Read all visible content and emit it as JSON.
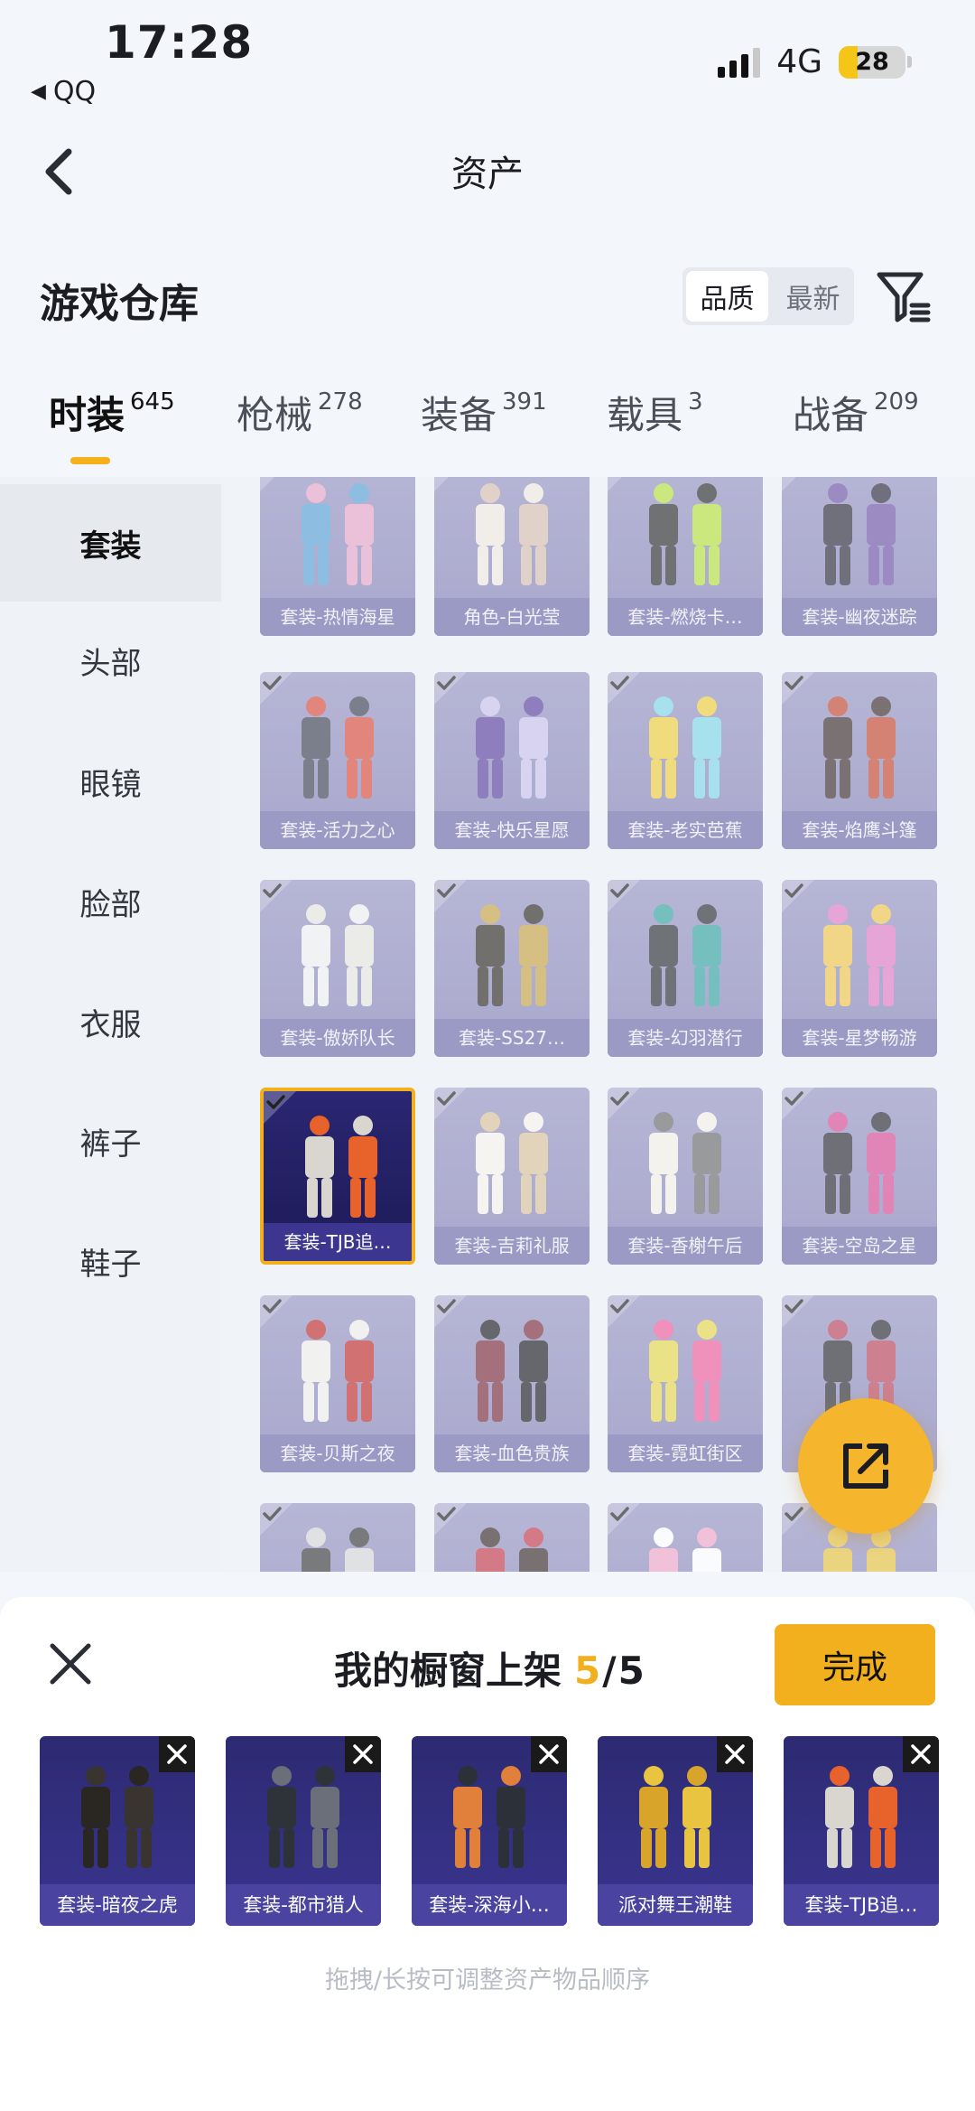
{
  "status_bar": {
    "time": "17:28",
    "back_app": "QQ",
    "network": "4G",
    "battery": "28",
    "battery_level_percent": 28
  },
  "nav": {
    "title": "资产"
  },
  "warehouse": {
    "title": "游戏仓库",
    "sort_options": [
      "品质",
      "最新"
    ],
    "sort_selected": "品质"
  },
  "tabs": [
    {
      "label": "时装",
      "count": "645",
      "active": true
    },
    {
      "label": "枪械",
      "count": "278",
      "active": false
    },
    {
      "label": "装备",
      "count": "391",
      "active": false
    },
    {
      "label": "载具",
      "count": "3",
      "active": false
    },
    {
      "label": "战备",
      "count": "209",
      "active": false
    }
  ],
  "sidebar": {
    "items": [
      {
        "label": "套装",
        "active": true
      },
      {
        "label": "头部",
        "active": false
      },
      {
        "label": "眼镜",
        "active": false
      },
      {
        "label": "脸部",
        "active": false
      },
      {
        "label": "衣服",
        "active": false
      },
      {
        "label": "裤子",
        "active": false
      },
      {
        "label": "鞋子",
        "active": false
      }
    ]
  },
  "grid": {
    "items": [
      {
        "caption": "套装-热情海星",
        "selected": false
      },
      {
        "caption": "角色-白光莹",
        "selected": false
      },
      {
        "caption": "套装-燃烧卡…",
        "selected": false
      },
      {
        "caption": "套装-幽夜迷踪",
        "selected": false
      },
      {
        "caption": "套装-活力之心",
        "selected": false
      },
      {
        "caption": "套装-快乐星愿",
        "selected": false
      },
      {
        "caption": "套装-老实芭蕉",
        "selected": false
      },
      {
        "caption": "套装-焰鹰斗篷",
        "selected": false
      },
      {
        "caption": "套装-傲娇队长",
        "selected": false
      },
      {
        "caption": "套装-SS27…",
        "selected": false
      },
      {
        "caption": "套装-幻羽潜行",
        "selected": false
      },
      {
        "caption": "套装-星梦畅游",
        "selected": false
      },
      {
        "caption": "套装-TJB追…",
        "selected": true
      },
      {
        "caption": "套装-吉莉礼服",
        "selected": false
      },
      {
        "caption": "套装-香榭午后",
        "selected": false
      },
      {
        "caption": "套装-空岛之星",
        "selected": false
      },
      {
        "caption": "套装-贝斯之夜",
        "selected": false
      },
      {
        "caption": "套装-血色贵族",
        "selected": false
      },
      {
        "caption": "套装-霓虹街区",
        "selected": false
      },
      {
        "caption": "",
        "selected": false
      },
      {
        "caption": "",
        "selected": false
      },
      {
        "caption": "",
        "selected": false
      },
      {
        "caption": "",
        "selected": false
      },
      {
        "caption": "",
        "selected": false
      }
    ]
  },
  "showcase": {
    "title": "我的橱窗上架",
    "current": "5",
    "total": "5",
    "done_label": "完成",
    "items": [
      {
        "caption": "套装-暗夜之虎"
      },
      {
        "caption": "套装-都市猎人"
      },
      {
        "caption": "套装-深海小…"
      },
      {
        "caption": "派对舞王潮鞋"
      },
      {
        "caption": "套装-TJB追…"
      }
    ],
    "hint": "拖拽/长按可调整资产物品顺序"
  },
  "colors": {
    "accent": "#f2b01e",
    "card_bg": "#8380b8",
    "selected_card_bg": "#2a2672",
    "page_bg": "#f3f7fb"
  }
}
